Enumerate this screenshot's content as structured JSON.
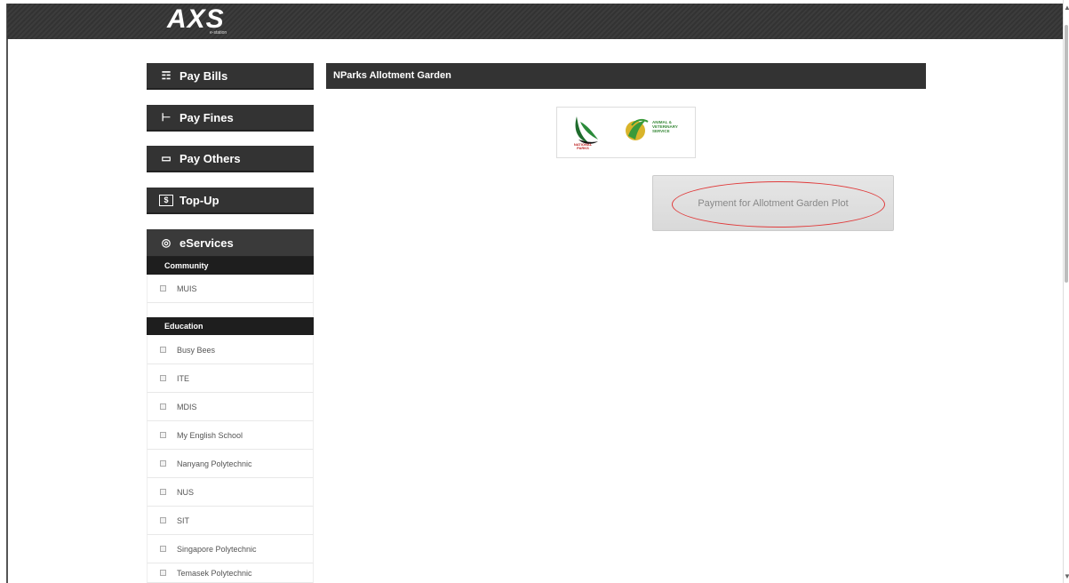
{
  "header": {
    "logo_text": "AXS",
    "logo_sub": "e-station"
  },
  "sidebar": {
    "pay_bills": "Pay Bills",
    "pay_fines": "Pay Fines",
    "pay_others": "Pay Others",
    "top_up": "Top-Up",
    "eservices": "eServices",
    "categories": [
      {
        "title": "Community",
        "items": [
          "MUIS"
        ]
      },
      {
        "title": "Education",
        "items": [
          "Busy Bees",
          "ITE",
          "MDIS",
          "My English School",
          "Nanyang Polytechnic",
          "NUS",
          "SIT",
          "Singapore Polytechnic",
          "Temasek Polytechnic"
        ]
      }
    ]
  },
  "main": {
    "title": "NParks Allotment Garden",
    "logos": {
      "nparks": "NATIONAL PARKS",
      "avs": "ANIMAL & VETERINARY SERVICE"
    },
    "payment_button": "Payment for Allotment Garden Plot"
  },
  "colors": {
    "header_bg": "#333333",
    "highlight": "#e03c3c",
    "button_bg": "#e0e0e0"
  }
}
